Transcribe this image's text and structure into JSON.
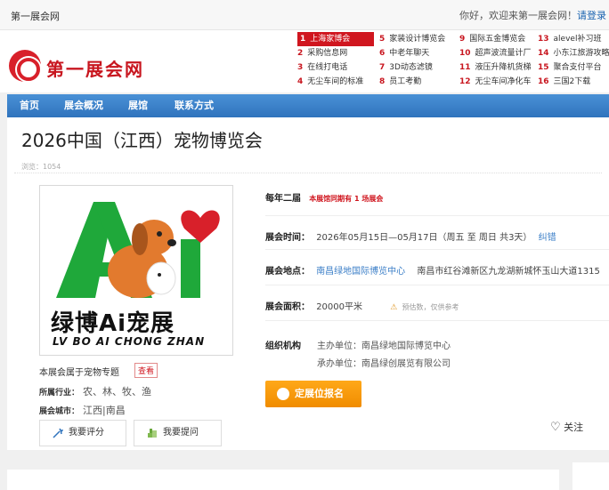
{
  "topbar": {
    "site": "第一展会网",
    "welcome": "你好，欢迎来第一展会网！",
    "login": "请登录"
  },
  "logo": {
    "text": "第一展会网"
  },
  "hot_list": [
    [
      "上海家博会",
      "采购信息网",
      "在线打电话",
      "无尘车间的标准"
    ],
    [
      "家装设计博览会",
      "中老年聊天",
      "3D动态滤镜",
      "员工考勤"
    ],
    [
      "国际五金博览会",
      "超声波流量计厂",
      "液压升降机货梯",
      "无尘车间净化车"
    ],
    [
      "alevel补习班",
      "小东江旅游攻略",
      "聚合支付平台",
      "三国2下载"
    ]
  ],
  "hot_numbers": [
    [
      "1",
      "2",
      "3",
      "4"
    ],
    [
      "5",
      "6",
      "7",
      "8"
    ],
    [
      "9",
      "10",
      "11",
      "12"
    ],
    [
      "13",
      "14",
      "15",
      "16"
    ]
  ],
  "nav": [
    "首页",
    "展会概况",
    "展馆",
    "联系方式"
  ],
  "expo": {
    "title": "2026中国（江西）宠物博览会",
    "views": "浏览：1054",
    "poster_brand": "绿博Ai宠展",
    "poster_brand_en": "LV BO AI CHONG ZHAN",
    "topic_text": "本展会属于宠物专题",
    "topic_tag": "查看",
    "industry_label": "所属行业：",
    "industry": "农、林、牧、渔",
    "city_label": "展会城市：",
    "city": "江西|南昌",
    "rate_button": "我要评分",
    "ask_button": "我要提问",
    "freq_label": "每年二届",
    "freq_note": "本展馆同期有 1 场展会",
    "time_label": "展会时间：",
    "time_value": "2026年05月15日—05月17日（周五 至 周日 共3天）",
    "time_error": "纠错",
    "place_label": "展会地点：",
    "place_venue": "南昌绿地国际博览中心",
    "place_address": "南昌市红谷滩新区九龙湖新城怀玉山大道1315",
    "area_label": "展会面积：",
    "area_value": "20000平米",
    "area_note": "预估数，仅供参考",
    "org_label": "组织机构",
    "host_label": "主办单位：",
    "host": "南昌绿地国际博览中心",
    "organizer_label": "承办单位：",
    "organizer": "南昌绿创展览有限公司",
    "apply_button": "定展位报名",
    "follow": "关注"
  },
  "colors": {
    "brand_red": "#d0161f",
    "nav_blue": "#2f73bd",
    "link_blue": "#3a7ec7",
    "apply_orange": "#f59a0a",
    "poster_green": "#1fa83a"
  }
}
